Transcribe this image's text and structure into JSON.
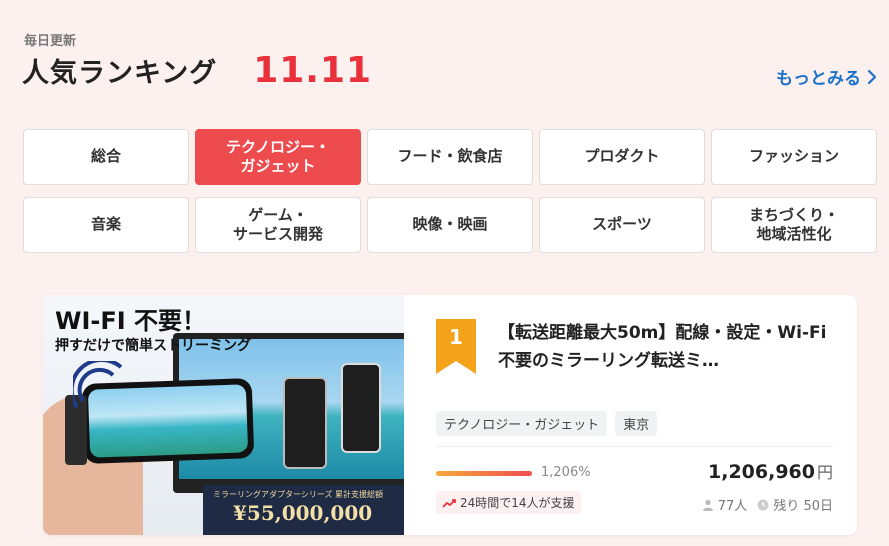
{
  "header": {
    "daily_label": "毎日更新",
    "title": "人気ランキング",
    "date": "11.11",
    "more_label": "もっとみる"
  },
  "categories": [
    {
      "label": "総合"
    },
    {
      "label": "テクノロジー・\nガジェット",
      "active": true
    },
    {
      "label": "フード・飲食店"
    },
    {
      "label": "プロダクト"
    },
    {
      "label": "ファッション"
    },
    {
      "label": "音楽"
    },
    {
      "label": "ゲーム・\nサービス開発"
    },
    {
      "label": "映像・映画"
    },
    {
      "label": "スポーツ"
    },
    {
      "label": "まちづくり・\n地域活性化"
    }
  ],
  "ranking": {
    "rank": "1",
    "title": "【転送距離最大50m】配線・設定・Wi-Fi不要のミラーリング転送ミ…",
    "tags": [
      "テクノロジー・ガジェット",
      "東京"
    ],
    "progress_percent": 100,
    "percent_label": "1,206%",
    "amount": "1,206,960",
    "currency": "円",
    "trend": "24時間で14人が支援",
    "supporters": "77人",
    "remaining": "残り 50日",
    "image": {
      "headline": "WI-FI 不要！",
      "subheadline": "押すだけで簡単ストリーミング",
      "banner_small": "ミラーリングアダプターシリーズ 累計支援総額",
      "banner_amount": "¥55,000,000"
    }
  },
  "colors": {
    "accent": "#ee4b4e",
    "link": "#1a73c9",
    "rank_badge": "#f5a21b",
    "date": "#e8313b"
  }
}
